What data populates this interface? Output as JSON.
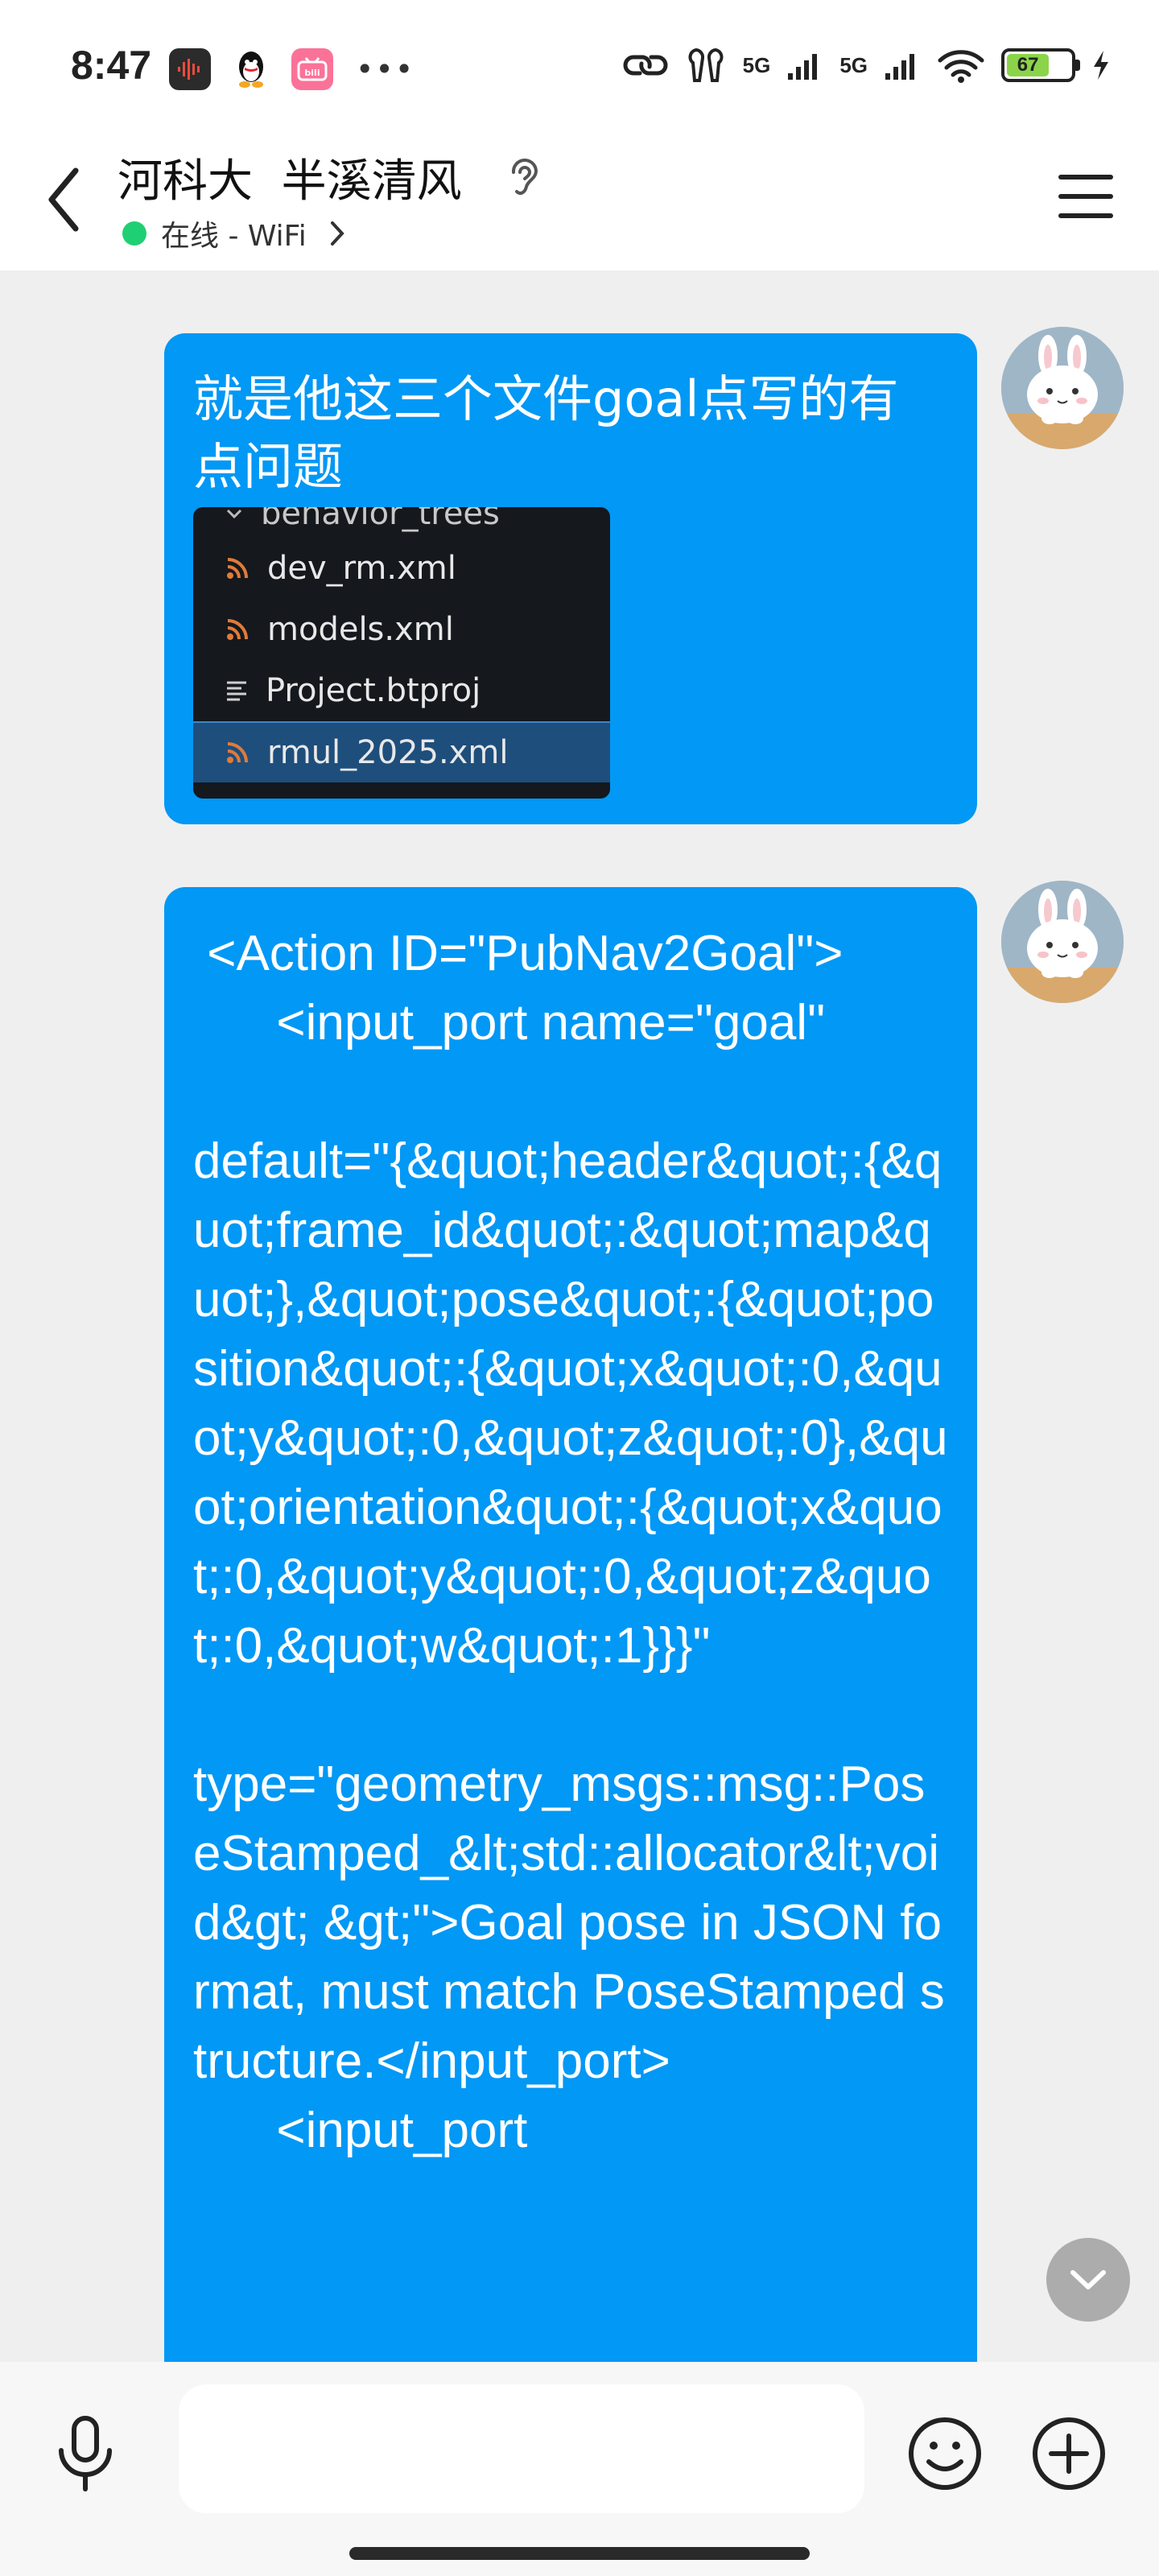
{
  "status_bar": {
    "time": "8:47",
    "network_1": "5G",
    "network_2": "5G",
    "battery_level": "67",
    "overflow": "•••"
  },
  "header": {
    "title": "河科大  半溪清风",
    "status": "在线 - WiFi"
  },
  "messages": [
    {
      "text": "就是他这三个文件goal点写的有点问题",
      "files": [
        {
          "name": "behavior_trees",
          "icon": "folder-chevron-icon"
        },
        {
          "name": "dev_rm.xml",
          "icon": "rss-icon"
        },
        {
          "name": "models.xml",
          "icon": "rss-icon"
        },
        {
          "name": "Project.btproj",
          "icon": "lines-icon"
        },
        {
          "name": "rmul_2025.xml",
          "icon": "rss-icon",
          "selected": true
        }
      ]
    },
    {
      "text": " <Action ID=\"PubNav2Goal\">\n      <input_port name=\"goal\"\n\ndefault=\"{&quot;header&quot;:{&quot;frame_id&quot;:&quot;map&quot;},&quot;pose&quot;:{&quot;position&quot;:{&quot;x&quot;:0,&quot;y&quot;:0,&quot;z&quot;:0},&quot;orientation&quot;:{&quot;x&quot;:0,&quot;y&quot;:0,&quot;z&quot;:0,&quot;w&quot;:1}}}\"\n\ntype=\"geometry_msgs::msg::PoseStamped_&lt;std::allocator&lt;void&gt; &gt;\">Goal pose in JSON format, must match PoseStamped structure.</input_port>\n      <input_port"
    }
  ],
  "input": {
    "value": "",
    "placeholder": ""
  },
  "colors": {
    "bubble": "#0298f5",
    "online": "#1fd072",
    "battery": "#8bd44a",
    "background": "#efefef"
  }
}
